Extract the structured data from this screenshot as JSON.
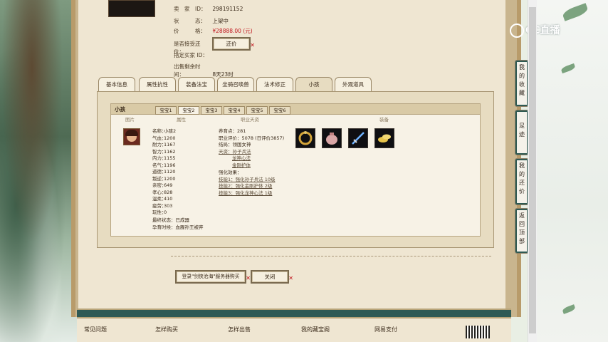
{
  "listing": {
    "seller_id_label": "卖　家　ID：",
    "seller_id": "298191152",
    "status_label": "状　　　态：",
    "status": "上架中",
    "price_label": "价　　　格：",
    "price": "¥28888.00 (元)",
    "bargain_label": "是否接受还价：",
    "bargain_button": "还价",
    "buyer_id_label": "指定买家 ID：",
    "buyer_id": "",
    "time_label": "出售剩余时间：",
    "time_left": "8天23时"
  },
  "tabs": [
    "基本信息",
    "属性抗性",
    "装备法宝",
    "坐骑召唤兽",
    "法术修正",
    "小孩",
    "外观道具"
  ],
  "active_tab": 5,
  "child": {
    "title": "小孩",
    "sub_tabs": [
      "宝宝1",
      "宝宝2",
      "宝宝3",
      "宝宝4",
      "宝宝5",
      "宝宝6"
    ],
    "active_sub_tab": 1,
    "col_headers": [
      "图片",
      "属性",
      "职业天资",
      "装备"
    ],
    "attrs": [
      {
        "k": "名称：",
        "v": "小孩2"
      },
      {
        "k": "气血：",
        "v": "1200"
      },
      {
        "k": "耐力：",
        "v": "1167"
      },
      {
        "k": "智力：",
        "v": "1162"
      },
      {
        "k": "内力：",
        "v": "1155"
      },
      {
        "k": "名气：",
        "v": "1196"
      },
      {
        "k": "道德：",
        "v": "1120"
      },
      {
        "k": "叛逆：",
        "v": "1200"
      },
      {
        "k": "亲密：",
        "v": "649"
      },
      {
        "k": "孝心：",
        "v": "828"
      },
      {
        "k": "温柔：",
        "v": "410"
      },
      {
        "k": "疲劳：",
        "v": "303"
      },
      {
        "k": "玩性：",
        "v": "0"
      },
      {
        "k": "最终状态：",
        "v": "已成器"
      },
      {
        "k": "孕育时候：",
        "v": "血腥孙王被弃"
      }
    ],
    "extras": [
      {
        "text": "养育点：281",
        "link": false
      },
      {
        "text": "职业评价：5078 (日评价3857)",
        "link": false
      },
      {
        "text": "结局：领国女神",
        "link": false
      },
      {
        "text": "天资：孙子兵法",
        "link": true
      },
      {
        "text": "龙神心法",
        "link": true
      },
      {
        "text": "金刚护体",
        "link": true
      },
      {
        "text": "强化效果：",
        "link": false
      },
      {
        "text": "技能1：强化孙子兵法 10级",
        "link": true
      },
      {
        "text": "技能2：强化金刚护体 2级",
        "link": true
      },
      {
        "text": "技能3：强化龙神心法 1级",
        "link": true
      }
    ],
    "equipment_icons": [
      "bracelet-icon",
      "pouch-icon",
      "sword-icon",
      "gold-ingot-icon"
    ]
  },
  "actions": {
    "login_button": "登录\"剑侠沧海\"服务器购买",
    "close_button": "关闭"
  },
  "side_tabs": [
    "我的收藏",
    "足迹",
    "我的还价",
    "返回顶部"
  ],
  "brand": "CC直播",
  "footer": [
    "常见问题",
    "怎样购买",
    "怎样出售",
    "我的藏宝阁",
    "网易支付"
  ],
  "colors": {
    "price": "#c0141c",
    "accent": "#2e5a55",
    "page_bg": "#efe6d2"
  }
}
